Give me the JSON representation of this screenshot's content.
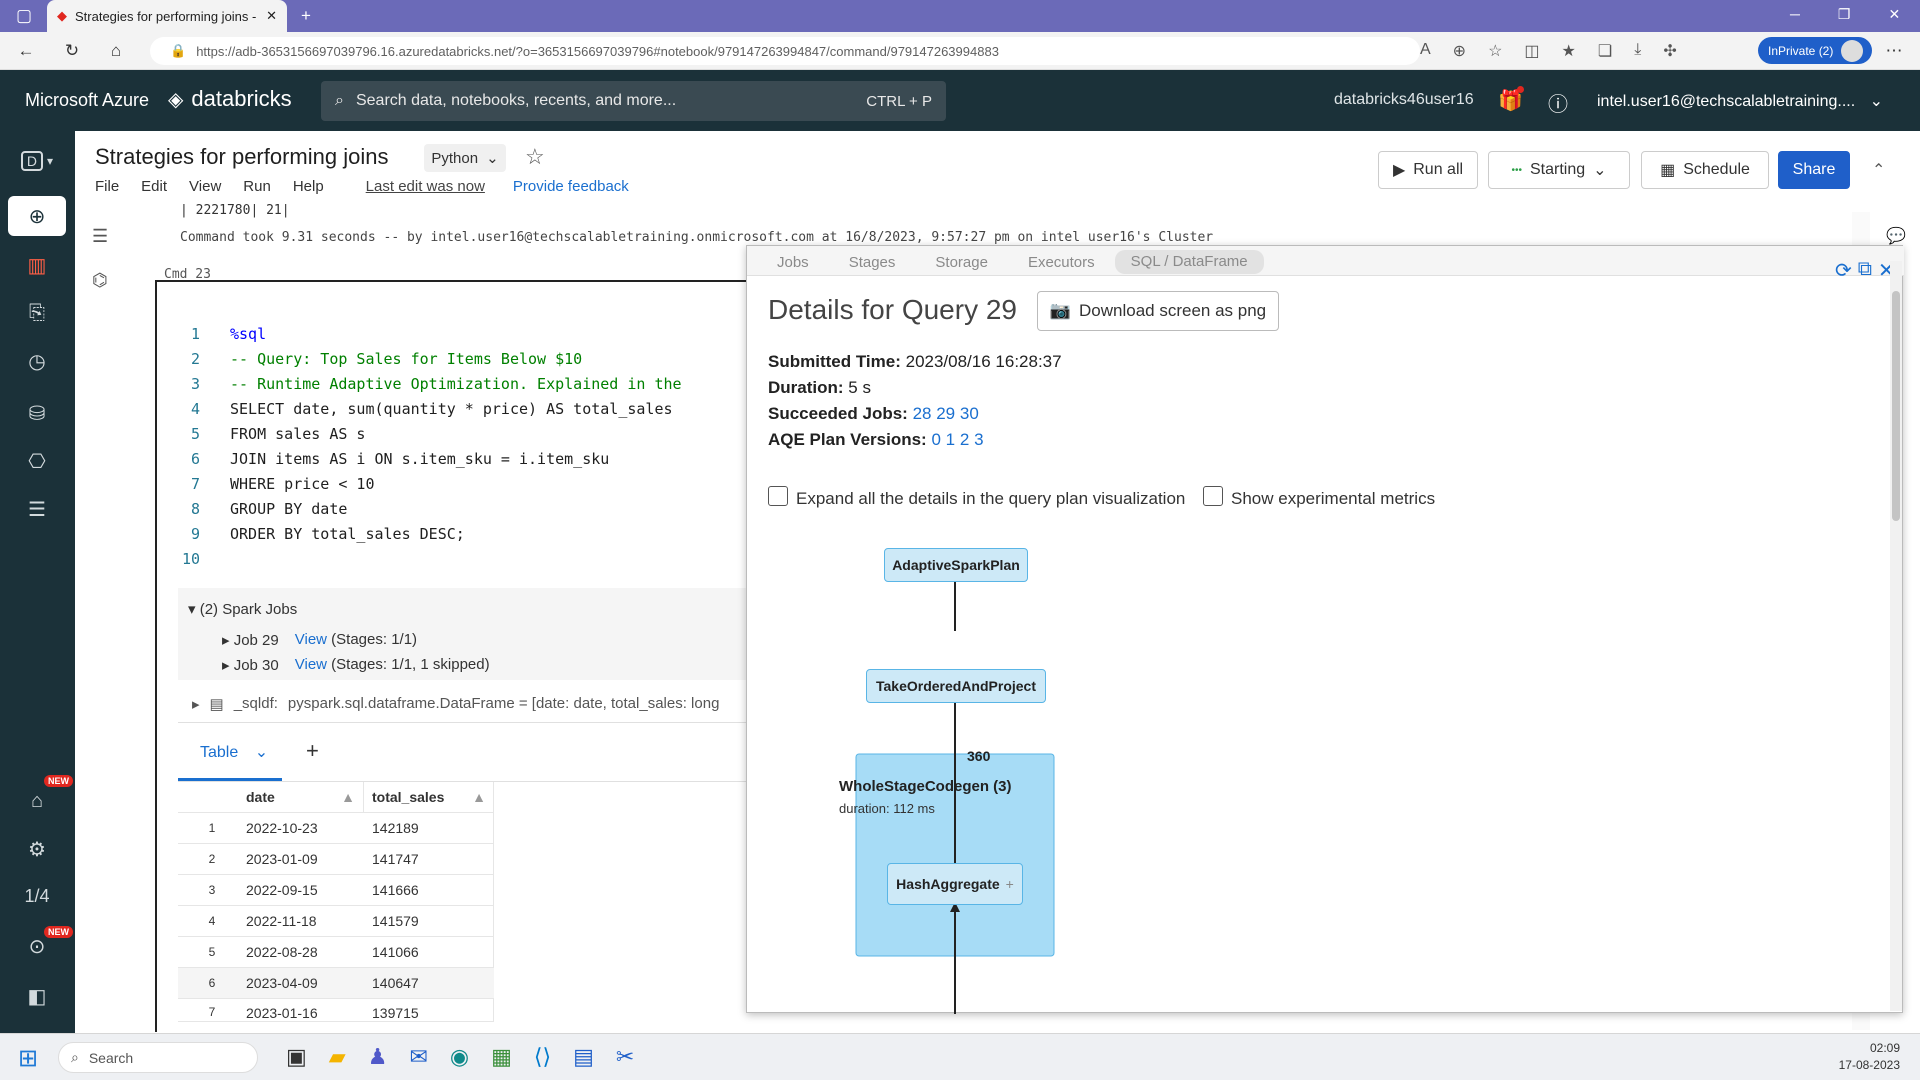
{
  "browser": {
    "tab_title": "Strategies for performing joins -",
    "url": "https://adb-3653156697039796.16.azuredatabricks.net/?o=3653156697039796#notebook/979147263994847/command/979147263994883",
    "inprivate_label": "InPrivate (2)"
  },
  "header": {
    "brand_azure": "Microsoft Azure",
    "brand_databricks": "databricks",
    "search_placeholder": "Search data, notebooks, recents, and more...",
    "search_shortcut": "CTRL + P",
    "workspace": "databricks46user16",
    "user": "intel.user16@techscalabletraining...."
  },
  "sidebar": {
    "new_badge": "NEW",
    "new_badge2": "NEW",
    "page_indicator": "1/4",
    "workspace_letter": "D"
  },
  "notebook": {
    "title": "Strategies for performing joins",
    "language": "Python",
    "menus": [
      "File",
      "Edit",
      "View",
      "Run",
      "Help"
    ],
    "last_edit": "Last edit was now",
    "feedback": "Provide feedback",
    "run_all": "Run all",
    "cluster_state": "Starting",
    "schedule": "Schedule",
    "share": "Share"
  },
  "prev_output": {
    "row_fragment": "| 2221780|       21|",
    "command_took": "Command took 9.31 seconds -- by intel.user16@techscalabletraining.onmicrosoft.com at 16/8/2023, 9:57:27 pm on intel user16's Cluster"
  },
  "cell": {
    "label": "Cmd 23",
    "lines": [
      {
        "n": "1",
        "t": "%sql"
      },
      {
        "n": "2",
        "t": "-- Query: Top Sales for Items Below $10"
      },
      {
        "n": "3",
        "t": "-- Runtime Adaptive Optimization. Explained in the"
      },
      {
        "n": "4",
        "t": "SELECT date, sum(quantity * price) AS total_sales"
      },
      {
        "n": "5",
        "t": "FROM sales AS s"
      },
      {
        "n": "6",
        "t": "JOIN items AS i ON s.item_sku = i.item_sku"
      },
      {
        "n": "7",
        "t": "WHERE price < 10"
      },
      {
        "n": "8",
        "t": "GROUP BY date"
      },
      {
        "n": "9",
        "t": "ORDER BY total_sales DESC;"
      },
      {
        "n": "10",
        "t": ""
      }
    ],
    "spark_jobs": "(2) Spark Jobs",
    "jobs": [
      {
        "name": "Job 29",
        "view": "View",
        "stages": "(Stages: 1/1)"
      },
      {
        "name": "Job 30",
        "view": "View",
        "stages": "(Stages: 1/1, 1 skipped)"
      }
    ],
    "df_var": "_sqldf:",
    "df_type": "pyspark.sql.dataframe.DataFrame = [date: date, total_sales: long",
    "table_tab": "Table",
    "columns": [
      "date",
      "total_sales"
    ],
    "rows": [
      [
        "1",
        "2022-10-23",
        "142189"
      ],
      [
        "2",
        "2023-01-09",
        "141747"
      ],
      [
        "3",
        "2022-09-15",
        "141666"
      ],
      [
        "4",
        "2022-11-18",
        "141579"
      ],
      [
        "5",
        "2022-08-28",
        "141066"
      ],
      [
        "6",
        "2023-04-09",
        "140647"
      ],
      [
        "7",
        "2023-01-16",
        "139715"
      ]
    ]
  },
  "sparkui": {
    "tabs": [
      "Jobs",
      "Stages",
      "Storage",
      "Executors",
      "SQL / DataFrame"
    ],
    "title": "Details for Query 29",
    "download": "Download screen as png",
    "submitted_label": "Submitted Time:",
    "submitted_value": "2023/08/16 16:28:37",
    "duration_label": "Duration:",
    "duration_value": "5 s",
    "jobs_label": "Succeeded Jobs:",
    "jobs_values": [
      "28",
      "29",
      "30"
    ],
    "aqe_label": "AQE Plan Versions:",
    "aqe_values": [
      "0",
      "1",
      "2",
      "3"
    ],
    "expand_label": "Expand all the details in the query plan visualization",
    "experimental_label": "Show experimental metrics",
    "nodes": {
      "adaptive": "AdaptiveSparkPlan",
      "take": "TakeOrderedAndProject",
      "edge_rows": "360",
      "wsc": "WholeStageCodegen (3)",
      "wsc_duration": "duration: 112 ms",
      "hashagg": "HashAggregate"
    }
  },
  "taskbar": {
    "search": "Search",
    "time": "02:09",
    "date": "17-08-2023"
  },
  "colors": {
    "tabstrip": "#6b6ab8",
    "azure_header": "#1b3139",
    "share_button": "#1f5fc9",
    "link": "#1a6fcf",
    "node_fill": "#cde9f7",
    "cluster_fill": "#a7dcf6"
  }
}
